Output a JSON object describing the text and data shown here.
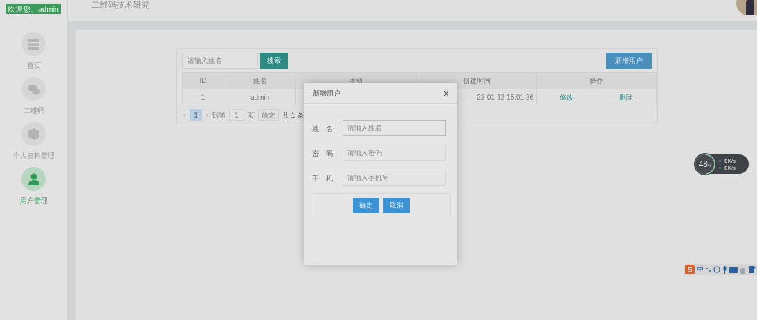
{
  "sidebar": {
    "welcome": "欢迎您、admin",
    "items": [
      {
        "label": "首页",
        "kind": "list",
        "selected": false
      },
      {
        "label": "二维码",
        "kind": "chat",
        "selected": false
      },
      {
        "label": "个人资料管理",
        "kind": "cube",
        "selected": false
      },
      {
        "label": "用户管理",
        "kind": "user",
        "selected": true
      }
    ]
  },
  "header": {
    "title": "二维码技术研究"
  },
  "toolbar": {
    "search_placeholder": "请输入姓名",
    "search_button": "搜索",
    "add_button": "新增用户"
  },
  "table": {
    "columns": [
      "ID",
      "姓名",
      "手机",
      "创建时间",
      "操作"
    ],
    "rows": [
      {
        "id": "1",
        "name": "admin",
        "created": "22-01-12 15:01:26",
        "actions": [
          "修改",
          "删除"
        ]
      }
    ]
  },
  "pagination": {
    "prev": "‹",
    "next": "›",
    "pages": [
      {
        "label": "1",
        "selected": true
      }
    ],
    "goto_label": "到第",
    "goto_value": "1",
    "page_unit": "页",
    "confirm": "确定",
    "total": "共 1 条"
  },
  "dialog": {
    "title": "新增用户",
    "close": "×",
    "fields": [
      {
        "label_1": "姓",
        "label_2": "名:",
        "placeholder": "请输入姓名",
        "focused": true
      },
      {
        "label_1": "密",
        "label_2": "码:",
        "placeholder": "请输入密码",
        "focused": false
      },
      {
        "label_1": "手",
        "label_2": "机:",
        "placeholder": "请输入手机号",
        "focused": false
      }
    ],
    "buttons": [
      "确定",
      "取消"
    ]
  },
  "speed_widget": {
    "percent": "48",
    "unit": "%",
    "level": 0.48,
    "rates": [
      {
        "value": "0",
        "unit": "K/s",
        "color": "#4a9fd8"
      },
      {
        "value": "0",
        "unit": "K/s",
        "color": "#3aa54a"
      }
    ]
  },
  "ime_bar": {
    "mode": "中"
  }
}
